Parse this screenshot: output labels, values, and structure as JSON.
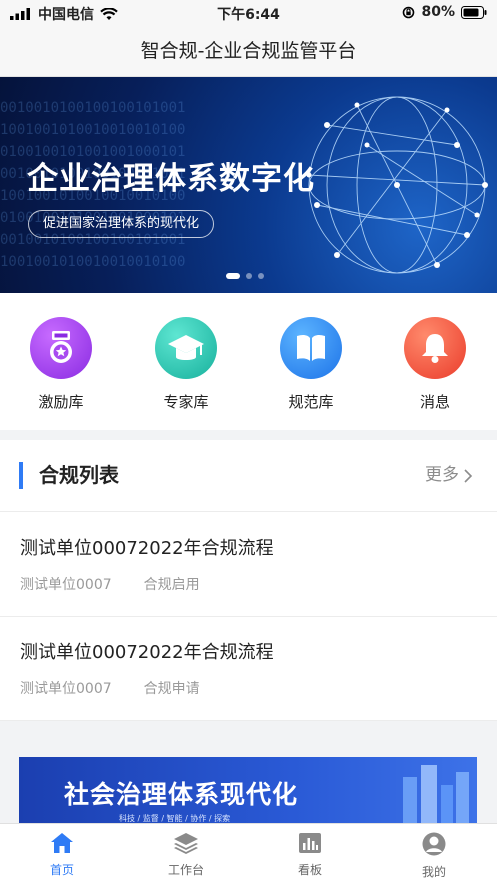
{
  "status_bar": {
    "carrier": "中国电信",
    "time": "下午6:44",
    "battery": "80%"
  },
  "app": {
    "title": "智合规-企业合规监管平台"
  },
  "banner": {
    "title": "企业治理体系数字化",
    "subtitle": "促进国家治理体系的现代化",
    "active_slide": 1,
    "slide_count": 3
  },
  "quick_links": [
    {
      "label": "激励库",
      "icon": "medal-icon",
      "color": "#9b3ff2"
    },
    {
      "label": "专家库",
      "icon": "graduation-cap-icon",
      "color": "#27c8b4"
    },
    {
      "label": "规范库",
      "icon": "book-icon",
      "color": "#2f8ff5"
    },
    {
      "label": "消息",
      "icon": "bell-icon",
      "color": "#f5533d"
    }
  ],
  "compliance_list": {
    "title": "合规列表",
    "more_label": "更多",
    "items": [
      {
        "title": "测试单位00072022年合规流程",
        "unit": "测试单位0007",
        "status": "合规启用"
      },
      {
        "title": "测试单位00072022年合规流程",
        "unit": "测试单位0007",
        "status": "合规申请"
      }
    ]
  },
  "promo_banner": {
    "title": "社会治理体系现代化",
    "subtitle": "科技 / 监督 / 智能 / 协作 / 探索"
  },
  "tabs": [
    {
      "label": "首页",
      "icon": "home-icon",
      "active": true
    },
    {
      "label": "工作台",
      "icon": "layers-icon",
      "active": false
    },
    {
      "label": "看板",
      "icon": "dashboard-icon",
      "active": false
    },
    {
      "label": "我的",
      "icon": "user-icon",
      "active": false
    }
  ],
  "colors": {
    "accent": "#2f7bf5",
    "banner_dark": "#071f5a"
  }
}
